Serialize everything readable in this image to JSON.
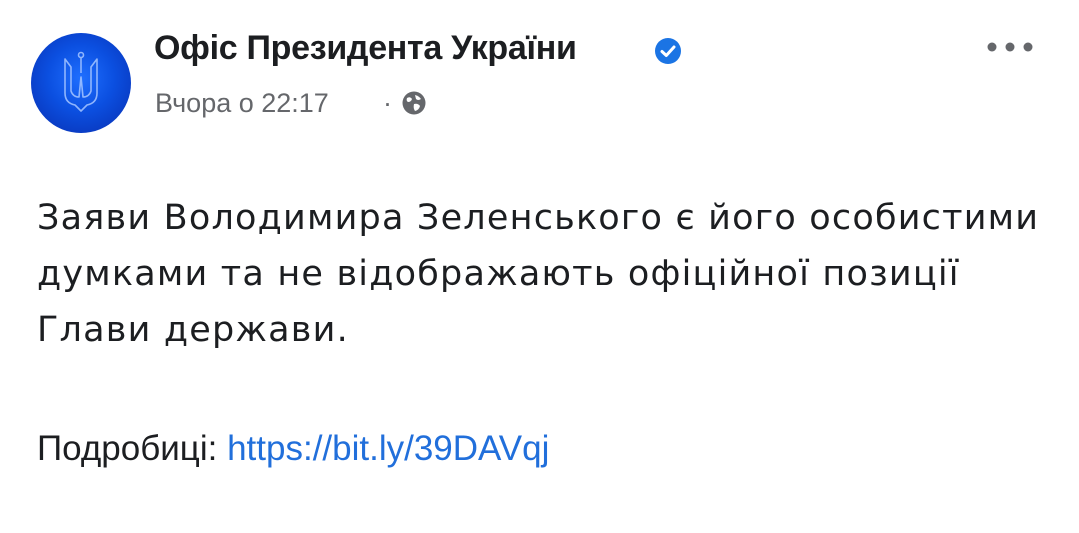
{
  "post": {
    "page_name": "Офіс Президента України",
    "timestamp": "Вчора о 22:17",
    "separator": "·",
    "privacy_icon": "globe-icon",
    "verified_icon": "verified-badge-icon",
    "more_icon": "more-options-icon",
    "text": "Заяви Володимира Зеленського є його особистими думками та не відображають офіційної позиції Глави держави.",
    "details_label": "Подробиці:",
    "link_text": "https://bit.ly/39DAVqj"
  },
  "colors": {
    "link": "#216fdb",
    "secondary_text": "#65676b",
    "primary_text": "#1c1e21",
    "verified": "#1b74e4",
    "avatar_blue": "#0b4fe0"
  }
}
